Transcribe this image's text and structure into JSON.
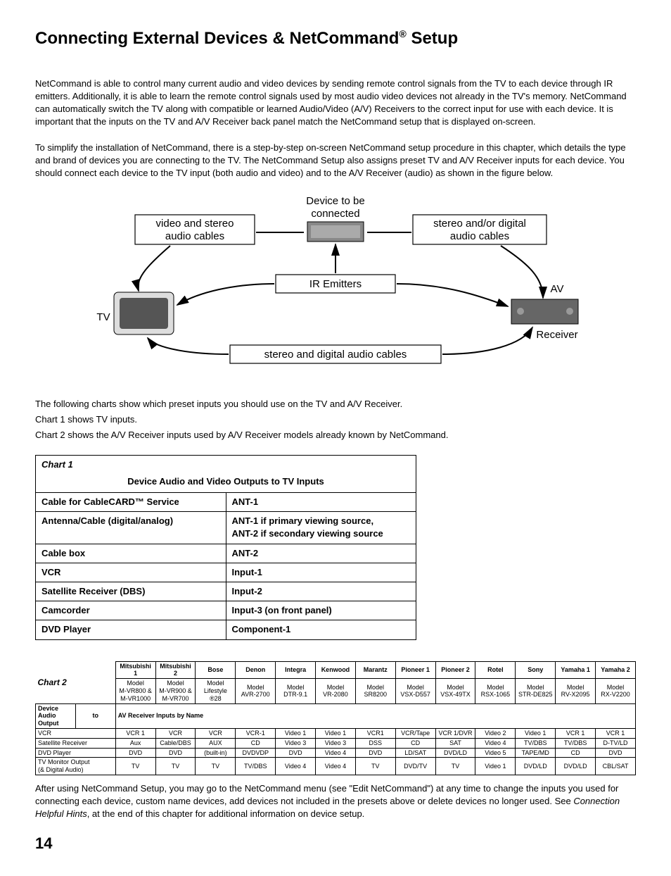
{
  "title_main": "Connecting External Devices & NetCommand",
  "title_reg": "®",
  "title_tail": " Setup",
  "para1": "NetCommand is able to control many current audio and video devices by sending remote control signals from the TV to each device through IR emitters.  Additionally, it is able to learn the remote control signals used by most audio video devices not already in the TV's memory.  NetCommand can automatically switch the TV along with compatible or learned Audio/Video (A/V) Receivers to the correct input for use with each device.  It is important that the inputs on the TV and A/V Receiver back panel match the NetCommand setup that is displayed on-screen.",
  "para2": "To simplify the installation of NetCommand, there is a step-by-step on-screen NetCommand setup procedure in this chapter, which details the type and brand of devices you are connecting to the TV.  The NetCommand Setup also assigns preset TV and A/V Receiver inputs for each device.  You should connect each device to the TV input (both audio and video) and to the A/V Receiver (audio) as shown in the figure below.",
  "diagram": {
    "device_line1": "Device to be",
    "device_line2": "connected",
    "cables_left_line1": "video and stereo",
    "cables_left_line2": "audio cables",
    "cables_right_line1": "stereo and/or digital",
    "cables_right_line2": "audio cables",
    "ir": "IR Emitters",
    "tv": "TV",
    "av_line1": "AV",
    "av_line2": "Receiver",
    "bottom_cables": "stereo and digital audio cables"
  },
  "para3_line1": "The following charts show which preset inputs you should use on the TV and A/V Receiver.",
  "para3_line2": "Chart 1 shows TV inputs.",
  "para3_line3": "Chart 2 shows the A/V Receiver inputs used by A/V Receiver models already known by NetCommand.",
  "chart1": {
    "label": "Chart 1",
    "title": "Device Audio and Video Outputs to TV Inputs",
    "rows": [
      {
        "left": "Cable for CableCARD™ Service",
        "right": "ANT-1"
      },
      {
        "left": "Antenna/Cable (digital/analog)",
        "right": "ANT-1 if primary viewing source,\nANT-2 if secondary viewing source"
      },
      {
        "left": "Cable box",
        "right": "ANT-2"
      },
      {
        "left": "VCR",
        "right": "Input-1"
      },
      {
        "left": "Satellite Receiver (DBS)",
        "right": "Input-2"
      },
      {
        "left": "Camcorder",
        "right": "Input-3 (on front panel)"
      },
      {
        "left": "DVD Player",
        "right": "Component-1"
      }
    ]
  },
  "chart2": {
    "label": "Chart 2",
    "side_header_top": "Device Audio Output",
    "side_header_to": "to",
    "side_header_span": "AV Receiver Inputs by Name",
    "brands": [
      "Mitsubishi 1",
      "Mitsubishi 2",
      "Bose",
      "Denon",
      "Integra",
      "Kenwood",
      "Marantz",
      "Pioneer 1",
      "Pioneer 2",
      "Rotel",
      "Sony",
      "Yamaha 1",
      "Yamaha 2"
    ],
    "models": [
      "Model\nM-VR800 &\nM-VR1000",
      "Model\nM-VR900 &\nM-VR700",
      "Model\nLifestyle ®28",
      "Model\nAVR-2700",
      "Model\nDTR-9.1",
      "Model\nVR-2080",
      "Model\nSR8200",
      "Model\nVSX-D557",
      "Model\nVSX-49TX",
      "Model\nRSX-1065",
      "Model\nSTR-DE825",
      "Model\nRV-X2095",
      "Model\nRX-V2200"
    ],
    "rows": [
      {
        "label": "VCR",
        "cells": [
          "VCR 1",
          "VCR",
          "VCR",
          "VCR-1",
          "Video 1",
          "Video 1",
          "VCR1",
          "VCR/Tape",
          "VCR 1/DVR",
          "Video 2",
          "Video 1",
          "VCR 1",
          "VCR 1"
        ]
      },
      {
        "label": "Satellite Receiver",
        "cells": [
          "Aux",
          "Cable/DBS",
          "AUX",
          "CD",
          "Video 3",
          "Video 3",
          "DSS",
          "CD",
          "SAT",
          "Video 4",
          "TV/DBS",
          "TV/DBS",
          "D-TV/LD"
        ]
      },
      {
        "label": "DVD Player",
        "cells": [
          "DVD",
          "DVD",
          "(built-in)",
          "DVDVDP",
          "DVD",
          "Video 4",
          "DVD",
          "LD/SAT",
          "DVD/LD",
          "Video 5",
          "TAPE/MD",
          "CD",
          "DVD"
        ]
      },
      {
        "label": "TV Monitor Output\n(& Digital Audio)",
        "cells": [
          "TV",
          "TV",
          "TV",
          "TV/DBS",
          "Video 4",
          "Video 4",
          "TV",
          "DVD/TV",
          "TV",
          "Video 1",
          "DVD/LD",
          "DVD/LD",
          "CBL/SAT"
        ]
      }
    ]
  },
  "para4_a": "After using NetCommand Setup, you may go to the NetCommand menu (see \"Edit NetCommand\") at any time to change the inputs you used for connecting each device, custom name devices, add devices not included in the presets above or delete devices no longer used.  See ",
  "para4_i": "Connection Helpful Hints",
  "para4_b": ", at the end of this chapter for additional information on device setup.",
  "page_number": "14"
}
